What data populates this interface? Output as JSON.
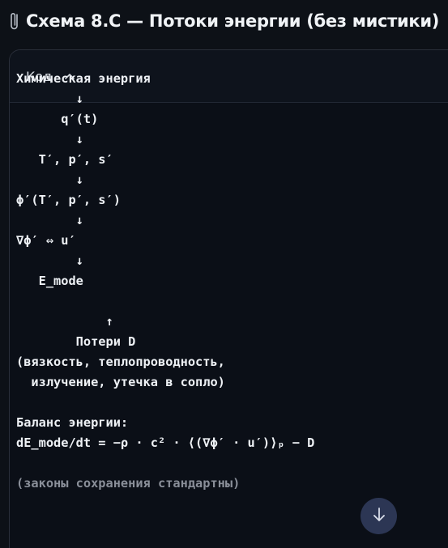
{
  "page": {
    "title": "Схема 8.C — Потоки энергии (без мистики)",
    "title_icon": "paperclip-icon"
  },
  "code_block": {
    "language_label": "Код",
    "collapse_icon": "chevron-up-icon",
    "lines": [
      "Химическая энергия",
      "        ↓",
      "      q′(t)",
      "        ↓",
      "   T′, p′, s′",
      "        ↓",
      "ϕ′(T′, p′, s′)",
      "        ↓",
      "∇ϕ′ ⇔ u′",
      "        ↓",
      "   E_mode",
      "",
      "            ↑",
      "        Потери D",
      "(вязкость, теплопроводность,",
      "  излучение, утечка в сопло)",
      "",
      "Баланс энергии:",
      "dE_mode/dt = −ρ · c² · ⟨(∇ϕ′ · u′)⟩ₚ − D",
      "",
      "(законы сохранения стандартны)"
    ]
  },
  "scroll_button": {
    "icon": "arrow-down-icon"
  },
  "colors": {
    "background": "#0d1117",
    "panel": "#0b0f17",
    "panel_border": "#2a2f3a",
    "text": "#eef1f5",
    "comment": "#8a8f99",
    "scroll_button": "#2c3654"
  }
}
